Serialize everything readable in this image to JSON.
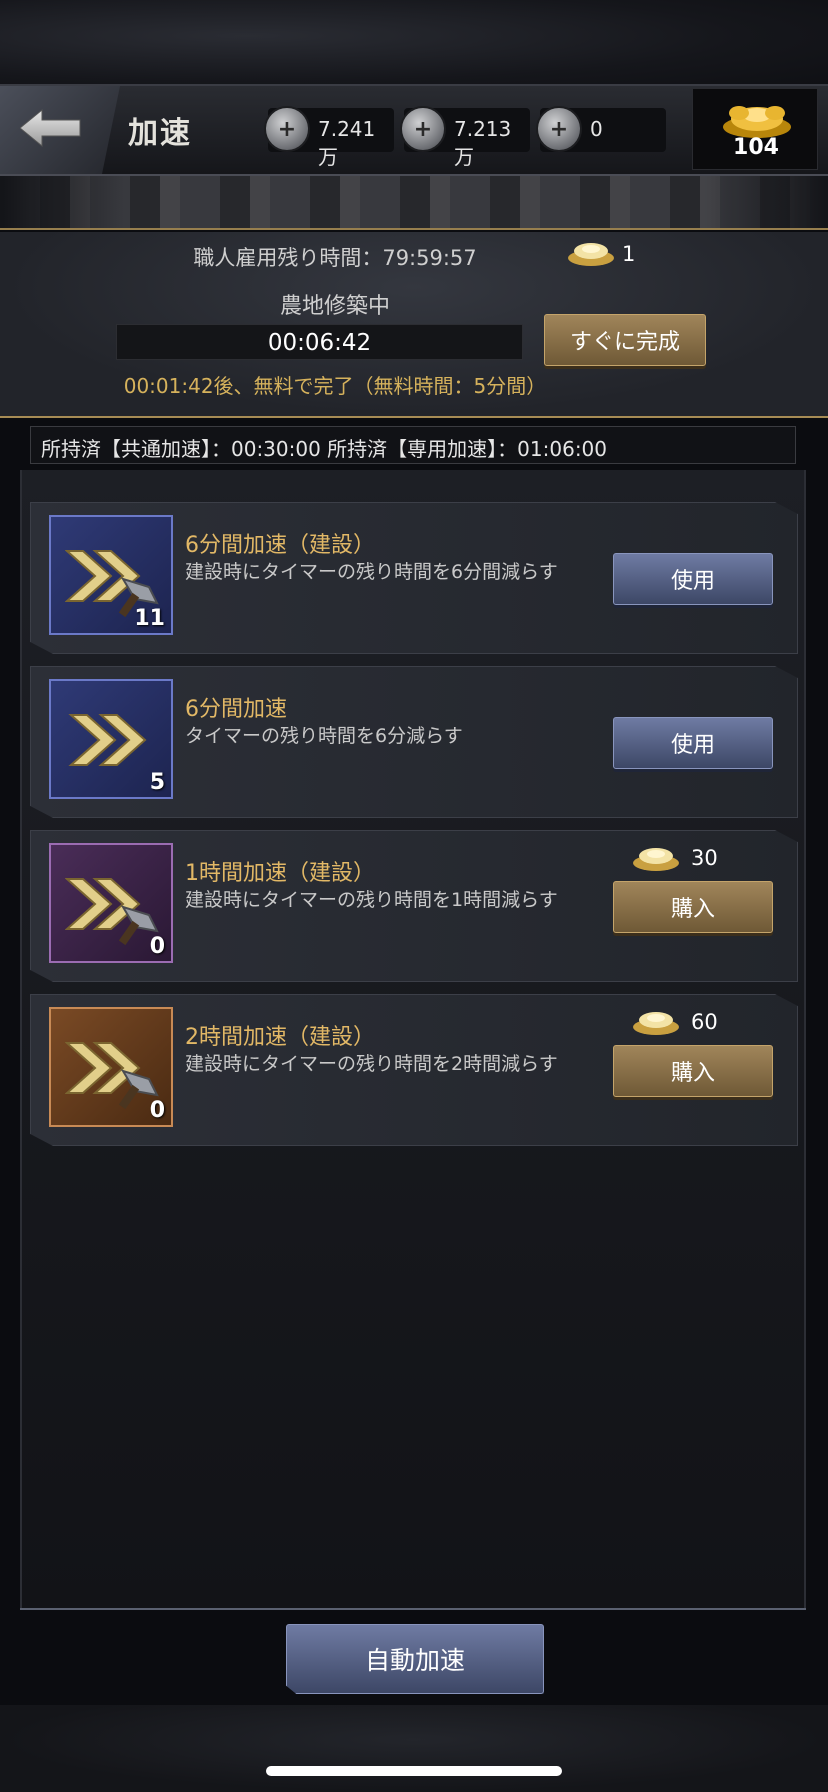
{
  "header": {
    "title": "加速",
    "back_icon": "arrow-left-icon",
    "resources": [
      {
        "icon": "grain-plus-icon",
        "value": "7.241万"
      },
      {
        "icon": "coin-plus-icon",
        "value": "7.213万"
      },
      {
        "icon": "material-plus-icon",
        "value": "0"
      }
    ],
    "gold": {
      "icon": "gold-ingot-icon",
      "value": "104"
    }
  },
  "info": {
    "hire_time": "職人雇用残り時間：79:59:57",
    "task": "農地修築中",
    "timer": "00:06:42",
    "free_note": "00:01:42後、無料で完了（無料時間：5分間）",
    "finish_cost": "1",
    "finish_label": "すぐに完成"
  },
  "owned": "所持済【共通加速】：00:30:00 所持済【専用加速】：01:06:00",
  "items": [
    {
      "name": "6分間加速（建設）",
      "desc": "建設時にタイマーの残り時間を6分間減らす",
      "count": "11",
      "action": "使用",
      "price": null
    },
    {
      "name": "6分間加速",
      "desc": "タイマーの残り時間を6分減らす",
      "count": "5",
      "action": "使用",
      "price": null
    },
    {
      "name": "1時間加速（建設）",
      "desc": "建設時にタイマーの残り時間を1時間減らす",
      "count": "0",
      "action": "購入",
      "price": "30"
    },
    {
      "name": "2時間加速（建設）",
      "desc": "建設時にタイマーの残り時間を2時間減らす",
      "count": "0",
      "action": "購入",
      "price": "60"
    }
  ],
  "auto_label": "自動加速",
  "colors": {
    "accent_gold": "#e2b866",
    "button_blue": "#4a5678",
    "button_gold": "#8a7048"
  }
}
